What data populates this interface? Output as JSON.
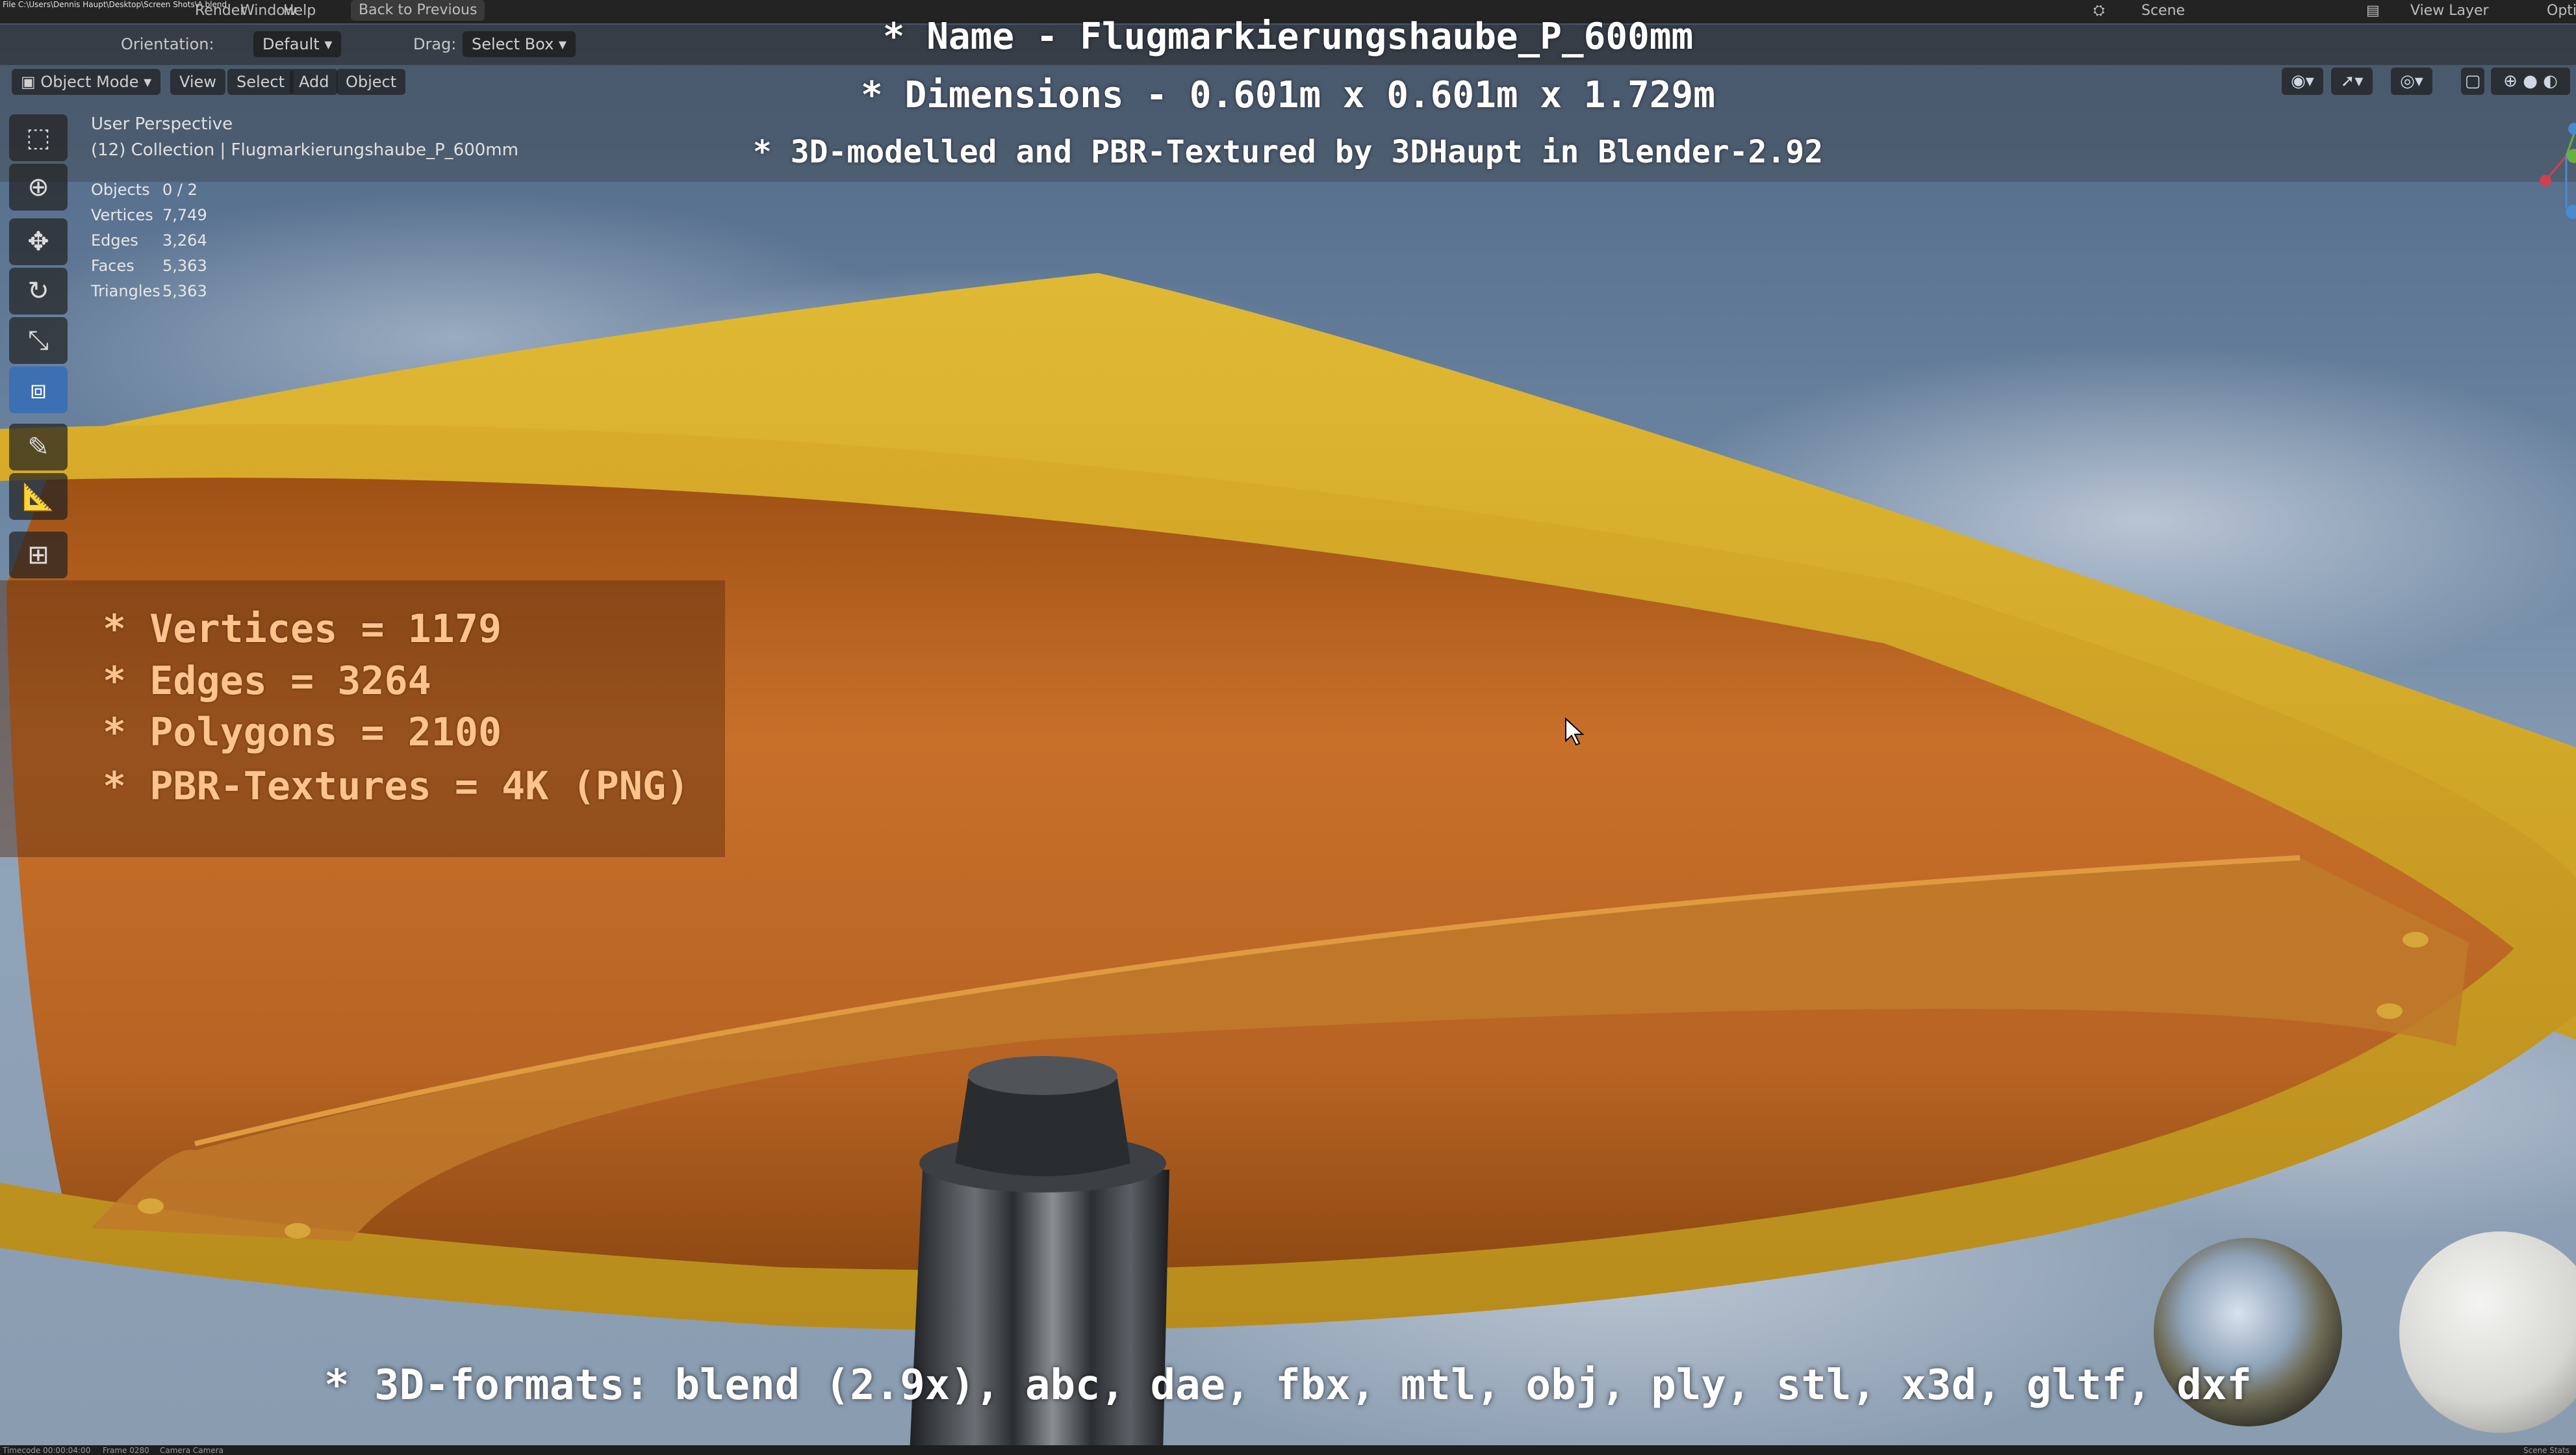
{
  "top_menu": {
    "file_info_line": "File C:\\Users\\Dennis Haupt\\Desktop\\Screen Shots\\A.blend",
    "menu_items": [
      "Render",
      "Window",
      "Help"
    ],
    "back_to_previous": "Back to Previous",
    "scene_label": "Scene",
    "view_layer_label": "View Layer",
    "options_label": "Opti"
  },
  "header": {
    "orientation_label": "Orientation:",
    "orientation_value": "Default",
    "drag_label": "Drag:",
    "drag_value": "Select Box",
    "mode": "Object Mode",
    "menus": [
      "View",
      "Select",
      "Add",
      "Object"
    ]
  },
  "viewport_info": {
    "perspective": "User Perspective",
    "collection": "(12) Collection | Flugmarkierungshaube_P_600mm"
  },
  "stats": [
    {
      "label": "Objects",
      "value": "0 / 2"
    },
    {
      "label": "Vertices",
      "value": "7,749"
    },
    {
      "label": "Edges",
      "value": "3,264"
    },
    {
      "label": "Faces",
      "value": "5,363"
    },
    {
      "label": "Triangles",
      "value": "5,363"
    }
  ],
  "title": {
    "name_line": "* Name - Flugmarkierungshaube_P_600mm",
    "dimensions_line": "* Dimensions -  0.601m x 0.601m x 1.729m",
    "author_line": "* 3D-modelled and PBR-Textured by 3DHaupt in Blender-2.92"
  },
  "info_box": {
    "vertices": "* Vertices = 1179",
    "edges": "* Edges = 3264",
    "polygons": "* Polygons = 2100",
    "textures": "* PBR-Textures = 4K (PNG)"
  },
  "formats_line": "* 3D-formats: blend (2.9x), abc, dae, fbx, mtl, obj, ply, stl, x3d, gltf, dxf",
  "status_bar": {
    "timecode": "Timecode 00:00:04:00",
    "frame": "Frame 0280",
    "camera": "Camera Camera",
    "scene_stats": "Scene Stats"
  },
  "colors": {
    "hood_yellow": "#d9b32c",
    "hood_underside": "#b5631f",
    "info_text": "#ffc38c",
    "active_tool": "#3d6fb3"
  },
  "icons": [
    "select-box-icon",
    "cursor-icon",
    "move-icon",
    "rotate-icon",
    "scale-icon",
    "transform-icon",
    "annotate-icon",
    "measure-icon",
    "add-cube-icon"
  ]
}
